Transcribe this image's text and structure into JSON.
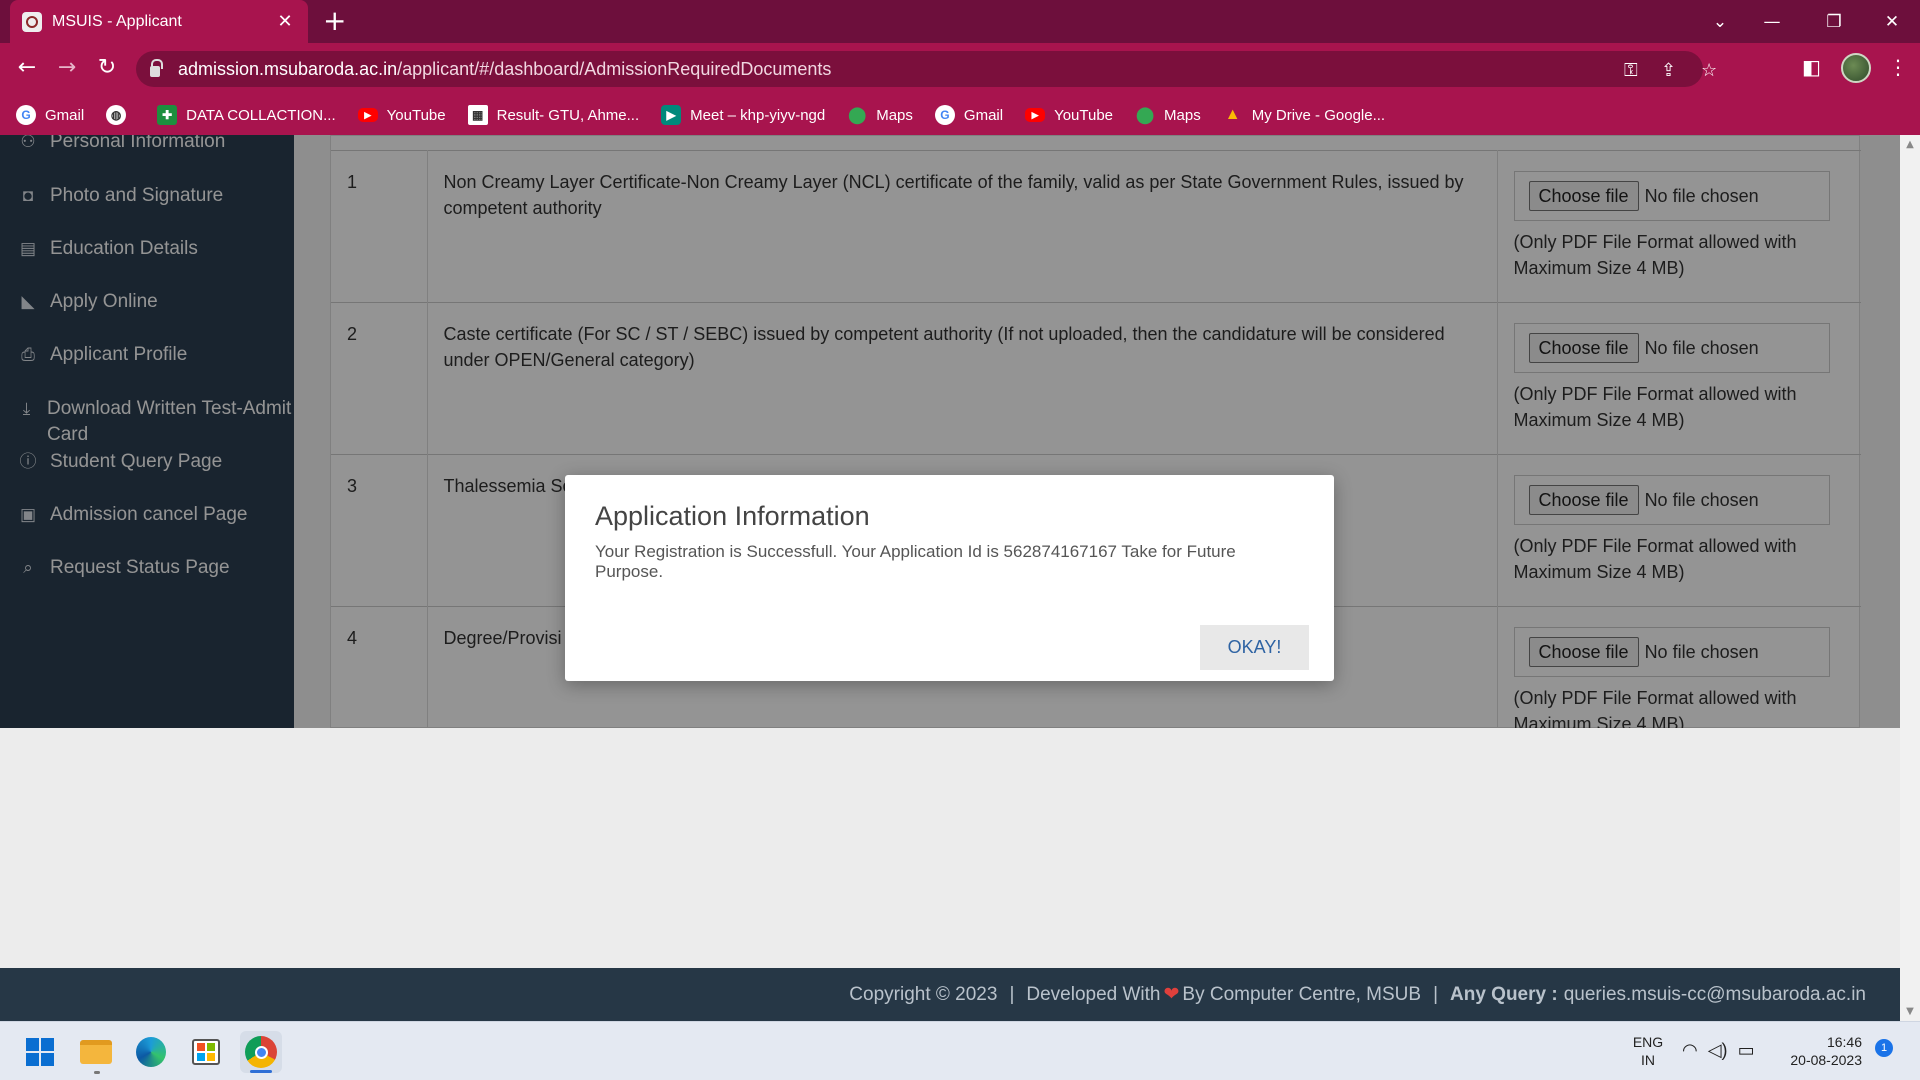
{
  "browser": {
    "tab_title": "MSUIS - Applicant",
    "url_domain": "admission.msubaroda.ac.in",
    "url_path": "/applicant/#/dashboard/AdmissionRequiredDocuments",
    "bookmarks": [
      {
        "label": "Gmail",
        "icon": "gmail-icon"
      },
      {
        "label": "",
        "icon": "web-icon"
      },
      {
        "label": "DATA COLLACTION...",
        "icon": "sheets-icon"
      },
      {
        "label": "YouTube",
        "icon": "youtube-icon"
      },
      {
        "label": "Result- GTU, Ahme...",
        "icon": "result-icon"
      },
      {
        "label": "Meet – khp-yiyv-ngd",
        "icon": "meet-icon"
      },
      {
        "label": "Maps",
        "icon": "maps-icon"
      },
      {
        "label": "Gmail",
        "icon": "gmail-icon"
      },
      {
        "label": "YouTube",
        "icon": "youtube-icon"
      },
      {
        "label": "Maps",
        "icon": "maps-icon"
      },
      {
        "label": "My Drive - Google...",
        "icon": "drive-icon"
      }
    ]
  },
  "sidebar": {
    "items": [
      {
        "label": "Personal Information",
        "icon": "person-icon"
      },
      {
        "label": "Photo and Signature",
        "icon": "camera-icon"
      },
      {
        "label": "Education Details",
        "icon": "book-icon"
      },
      {
        "label": "Apply Online",
        "icon": "graduation-cap-icon"
      },
      {
        "label": "Applicant Profile",
        "icon": "print-icon"
      },
      {
        "label": "Download Written Test-Admit Card",
        "icon": "download-icon"
      },
      {
        "label": "Student Query Page",
        "icon": "question-icon"
      },
      {
        "label": "Admission cancel Page",
        "icon": "calendar-x-icon"
      },
      {
        "label": "Request Status Page",
        "icon": "search-doc-icon"
      }
    ]
  },
  "documents": {
    "rows": [
      {
        "num": "1",
        "desc": "Non Creamy Layer Certificate-Non Creamy Layer (NCL) certificate of the family, valid as per State Government Rules, issued by competent authority"
      },
      {
        "num": "2",
        "desc": "Caste certificate (For SC / ST / SEBC) issued by competent authority (If not uploaded, then the candidature will be considered under OPEN/General category)"
      },
      {
        "num": "3",
        "desc": "Thalessemia Sc"
      },
      {
        "num": "4",
        "desc": "Degree/Provisi"
      }
    ],
    "choose_file": "Choose file",
    "no_file": "No file chosen",
    "hint": "(Only PDF File Format allowed with Maximum Size 4 MB)"
  },
  "modal": {
    "title": "Application Information",
    "body": "Your Registration is Successfull. Your Application Id is 562874167167 Take for Future Purpose.",
    "ok_label": "OKAY!"
  },
  "footer": {
    "copyright": "Copyright © 2023",
    "sep": "|",
    "developed": "Developed With",
    "by": "By Computer Centre, MSUB",
    "query_label": "Any Query :",
    "query_email": "queries.msuis-cc@msubaroda.ac.in"
  },
  "taskbar": {
    "lang_top": "ENG",
    "lang_bottom": "IN",
    "time": "16:46",
    "date": "20-08-2023",
    "notification_count": "1"
  }
}
